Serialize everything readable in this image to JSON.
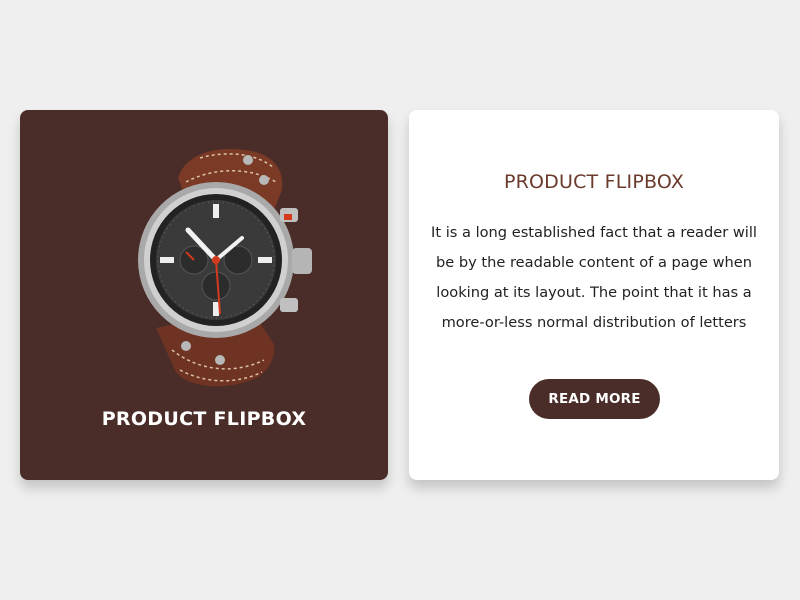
{
  "front_card": {
    "image_icon": "wristwatch-image",
    "title": "PRODUCT FLIPBOX"
  },
  "back_card": {
    "title": "PRODUCT FLIPBOX",
    "description_lines": [
      "It is a long established fact that a reader will",
      "be  by the readable content of a page when",
      "looking at its layout. The point that it has a",
      "more-or-less normal distribution of letters"
    ],
    "button_label": "READ MORE"
  },
  "colors": {
    "page_background": "#efefef",
    "brand_brown": "#4a2d28",
    "title_brown": "#6b3a2c",
    "card_white": "#ffffff"
  }
}
